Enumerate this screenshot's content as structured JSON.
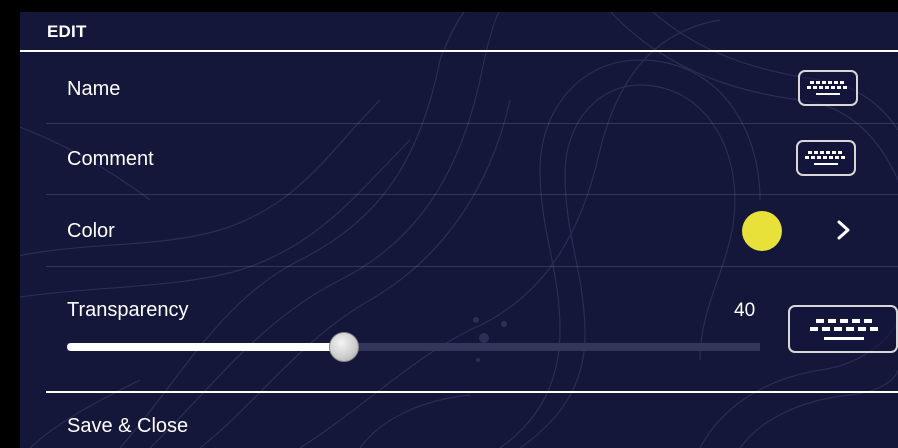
{
  "header": {
    "title": "EDIT"
  },
  "rows": {
    "name": {
      "label": "Name",
      "button_icon": "keyboard-icon"
    },
    "comment": {
      "label": "Comment",
      "button_icon": "keyboard-icon"
    },
    "color": {
      "label": "Color",
      "value_color": "#e8e13a",
      "chevron_icon": "chevron-right-icon"
    },
    "transparency": {
      "label": "Transparency",
      "value": "40",
      "slider_fraction": 0.4,
      "button_icon": "keyboard-icon"
    }
  },
  "footer": {
    "save_label": "Save & Close"
  },
  "colors": {
    "background": "#14163a",
    "accent_white": "#ffffff",
    "swatch": "#e8e13a"
  }
}
